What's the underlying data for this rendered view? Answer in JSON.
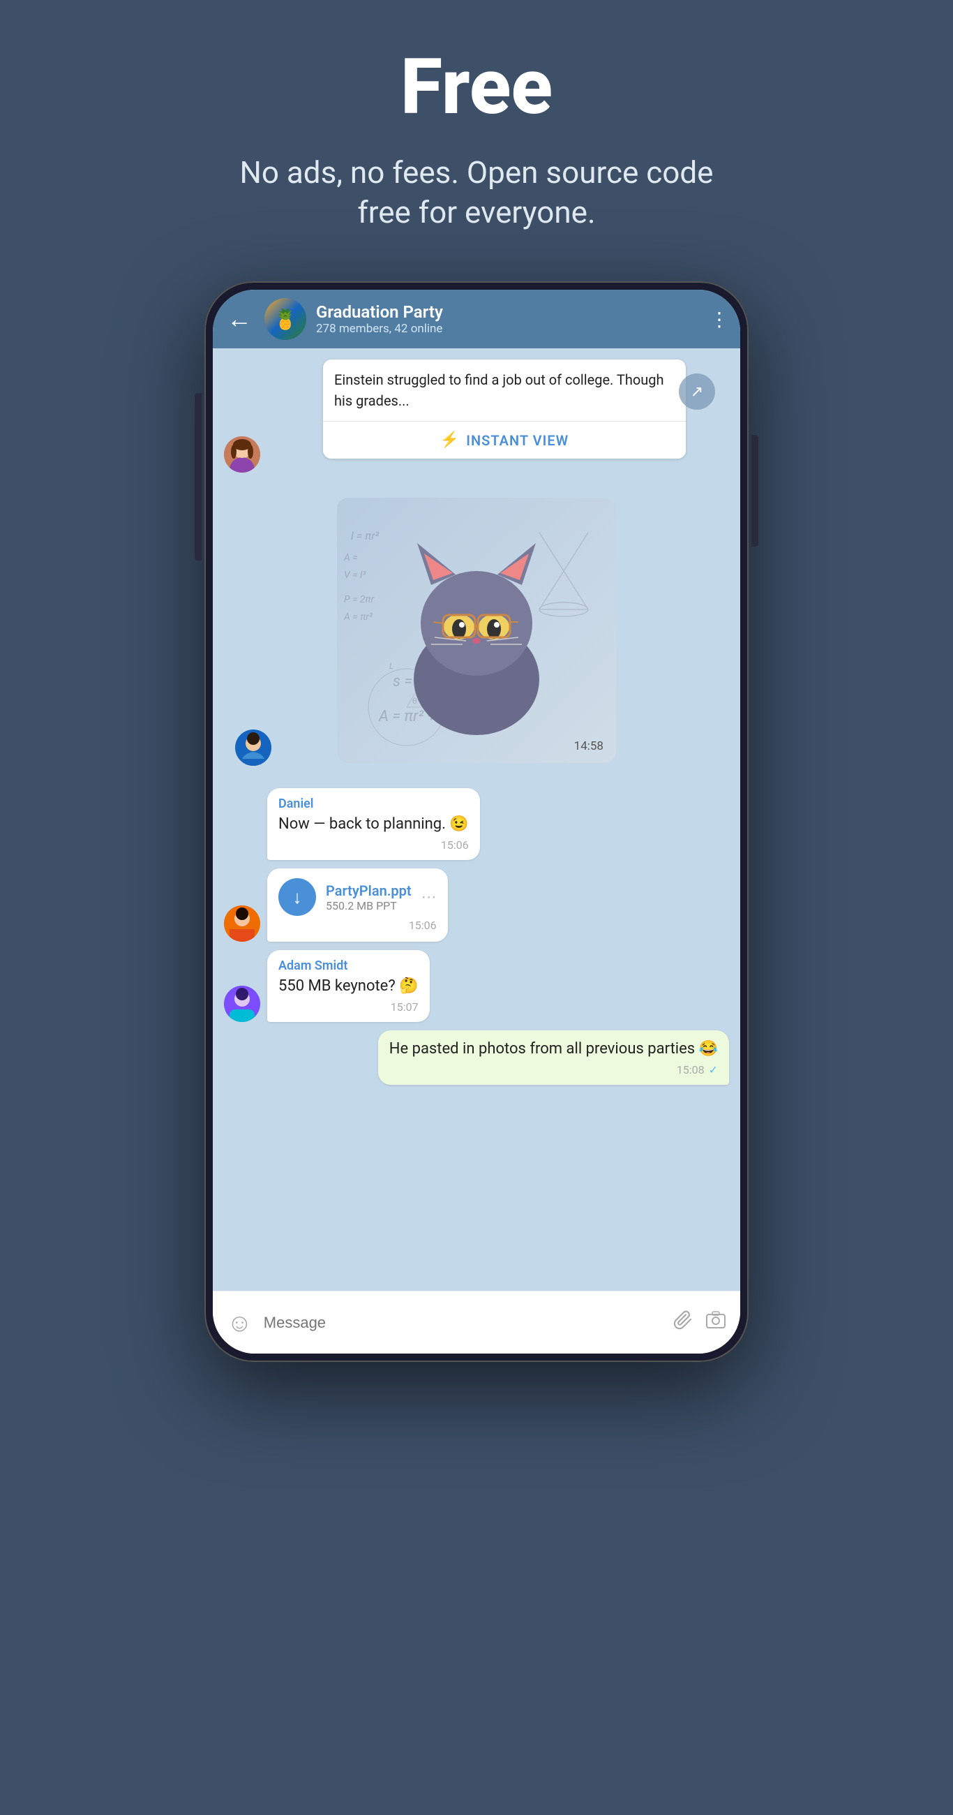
{
  "page": {
    "title": "Free",
    "subtitle": "No ads, no fees. Open source code free for everyone."
  },
  "chat": {
    "group_name": "Graduation Party",
    "group_info": "278 members, 42 online",
    "back_label": "←",
    "menu_label": "⋮"
  },
  "messages": {
    "article_text": "Einstein struggled to find a job out of college. Though his grades...",
    "instant_view_label": "INSTANT VIEW",
    "instant_view_icon": "⚡",
    "sticker_time": "14:58",
    "msg1": {
      "sender": "Daniel",
      "text": "Now — back to planning. 😉",
      "time": "15:06"
    },
    "file": {
      "name": "PartyPlan.ppt",
      "size": "550.2 MB PPT",
      "time": "15:06",
      "download_icon": "↓",
      "menu_icon": "⋯"
    },
    "msg2": {
      "sender": "Adam Smidt",
      "text": "550 MB keynote? 🤔",
      "time": "15:07"
    },
    "msg3": {
      "text": "He pasted in photos from all previous parties 😂",
      "time": "15:08",
      "check": "✓"
    }
  },
  "input_bar": {
    "placeholder": "Message",
    "emoji_icon": "☺",
    "attachment_icon": "📎",
    "camera_icon": "⊙"
  }
}
